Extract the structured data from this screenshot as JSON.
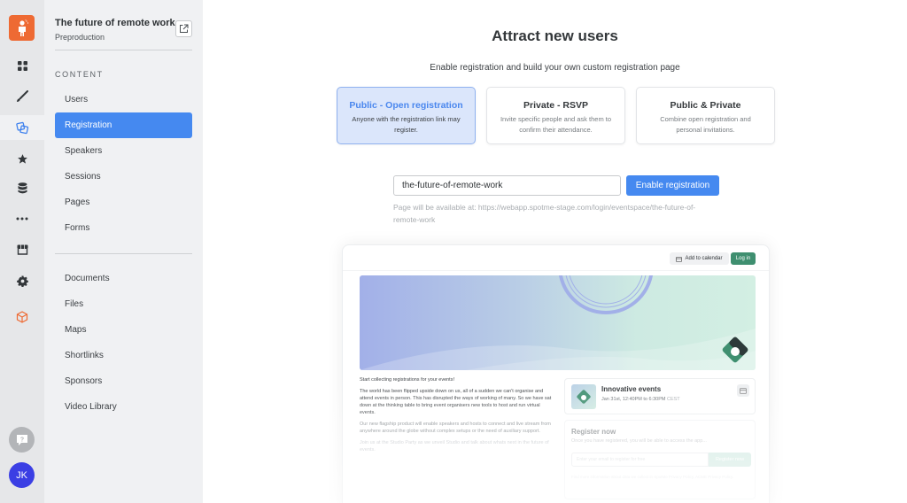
{
  "rail": {
    "logo_icon": "person-logo-icon",
    "items": [
      {
        "icon": "dashboard-grid-icon"
      },
      {
        "icon": "brush-icon"
      },
      {
        "icon": "content-pages-icon",
        "active": true
      },
      {
        "icon": "star-icon"
      },
      {
        "icon": "database-icon"
      },
      {
        "icon": "more-dots-icon"
      },
      {
        "icon": "store-icon"
      },
      {
        "icon": "gear-icon"
      },
      {
        "icon": "cube-icon"
      }
    ],
    "help_icon": "help-chat-icon",
    "avatar_initials": "JK",
    "colors": {
      "logo": "#ee6a33",
      "avatar": "#3b3fe4",
      "active": "#3f82ee",
      "cube": "#ee6a33"
    }
  },
  "sidebar": {
    "event_title": "The future of remote work",
    "event_subtitle": "Preproduction",
    "section_label": "CONTENT",
    "items_top": [
      "Users",
      "Registration",
      "Speakers",
      "Sessions",
      "Pages",
      "Forms"
    ],
    "active_item": "Registration",
    "items_bottom": [
      "Documents",
      "Files",
      "Maps",
      "Shortlinks",
      "Sponsors",
      "Video Library"
    ]
  },
  "main": {
    "title": "Attract new users",
    "subtitle": "Enable registration and build your own custom registration page",
    "options": [
      {
        "title": "Public - Open registration",
        "desc": "Anyone with the registration link may register.",
        "selected": true
      },
      {
        "title": "Private - RSVP",
        "desc": "Invite specific people and ask them to confirm their attendance.",
        "selected": false
      },
      {
        "title": "Public & Private",
        "desc": "Combine open registration and personal invitations.",
        "selected": false
      }
    ],
    "slug_value": "the-future-of-remote-work",
    "enable_button": "Enable registration",
    "availability_note": "Page will be available at: https://webapp.spotme-stage.com/login/eventspace/the-future-of-remote-work"
  },
  "preview": {
    "add_to_calendar": "Add to calendar",
    "login": "Log in",
    "intro": "Start collecting registrations for your events!",
    "para1": "The world has been flipped upside down on us, all of a sudden we can't organise and attend events in person. This has disrupted the ways of working of many. So we have sat down at the thinking table to bring event organisers new tools to host and run virtual events.",
    "para2": "Our new flagship product will enable speakers and hosts to connect and live stream from anywhere around the globe without complex setups or the need of auxiliary support.",
    "para3": "Join us at the Studio Party as we unveil Studio and talk about whats next in the future of events.",
    "event_name": "Innovative events",
    "event_date": "Jan 31st, 12:40PM to 6:30PM",
    "event_tz": "CEST",
    "register_title": "Register now",
    "register_sub": "Once you have registered, you will be able to access the app...",
    "email_placeholder": "Enter your email to register for free",
    "register_button": "Register now",
    "footer": "Find more information about data we collect in SpotMe Privacy Policy, ACME Privacy Policy.",
    "colors": {
      "login": "#3f8f70",
      "register_button": "#c9e6dd"
    }
  }
}
